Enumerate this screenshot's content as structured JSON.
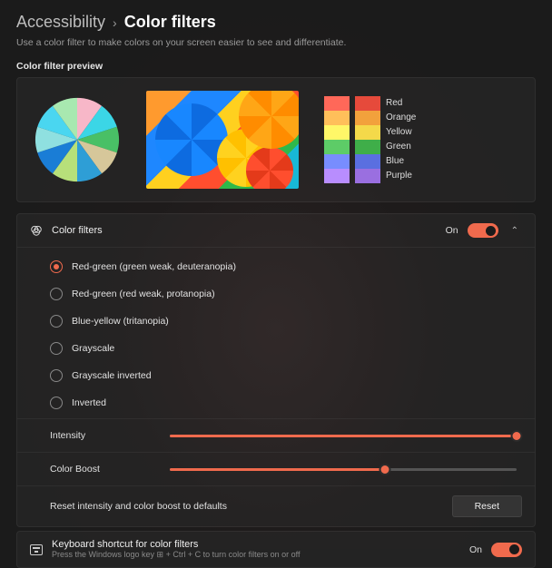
{
  "breadcrumb": {
    "parent": "Accessibility",
    "current": "Color filters"
  },
  "subtitle": "Use a color filter to make colors on your screen easier to see and differentiate.",
  "preview": {
    "label": "Color filter preview",
    "palette": [
      {
        "color": "#e64a3b",
        "label": "Red"
      },
      {
        "color": "#f2a13c",
        "label": "Orange"
      },
      {
        "color": "#f4d94a",
        "label": "Yellow"
      },
      {
        "color": "#3fae49",
        "label": "Green"
      },
      {
        "color": "#5a6fe0",
        "label": "Blue"
      },
      {
        "color": "#9a6fe0",
        "label": "Purple"
      }
    ]
  },
  "filters": {
    "title": "Color filters",
    "state_label": "On",
    "options": [
      {
        "label": "Red-green (green weak, deuteranopia)",
        "selected": true
      },
      {
        "label": "Red-green (red weak, protanopia)",
        "selected": false
      },
      {
        "label": "Blue-yellow (tritanopia)",
        "selected": false
      },
      {
        "label": "Grayscale",
        "selected": false
      },
      {
        "label": "Grayscale inverted",
        "selected": false
      },
      {
        "label": "Inverted",
        "selected": false
      }
    ]
  },
  "sliders": {
    "intensity": {
      "label": "Intensity",
      "value": 100
    },
    "color_boost": {
      "label": "Color Boost",
      "value": 62
    }
  },
  "reset": {
    "label": "Reset intensity and color boost to defaults",
    "button": "Reset"
  },
  "shortcut": {
    "title": "Keyboard shortcut for color filters",
    "desc": "Press the Windows logo key ⊞ + Ctrl + C to turn color filters on or off",
    "state_label": "On"
  },
  "accent": "#f06a4d"
}
